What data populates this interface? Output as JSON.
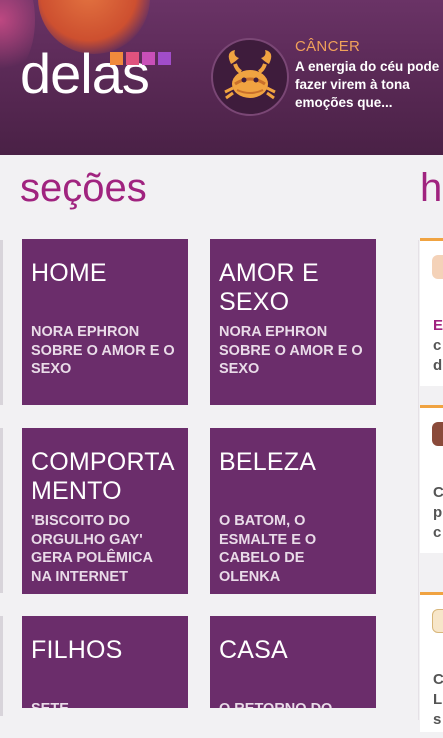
{
  "brand": {
    "logo_text": "delas",
    "logo_squares": [
      "#f08a3c",
      "#e0527e",
      "#c94fb8",
      "#a14dc9"
    ]
  },
  "horoscope": {
    "sign": "CÂNCER",
    "text": "A energia do céu pode fazer virem à tona emoções que...",
    "icon": "crab-icon"
  },
  "sections_heading": "seções",
  "next_panel_heading": "h",
  "tiles": [
    {
      "title": "HOME",
      "subtitle": "NORA EPHRON SOBRE O AMOR E O SEXO"
    },
    {
      "title": "AMOR E SEXO",
      "subtitle": "NORA EPHRON SOBRE O AMOR E O SEXO"
    },
    {
      "title": "COMPORTA MENTO",
      "subtitle": "'BISCOITO DO ORGULHO GAY' GERA POLÊMICA NA INTERNET"
    },
    {
      "title": "BELEZA",
      "subtitle": "O BATOM, O ESMALTE E O CABELO DE OLENKA"
    },
    {
      "title": "FILHOS",
      "subtitle": "SETE"
    },
    {
      "title": "CASA",
      "subtitle": "O RETORNO DO"
    }
  ],
  "side_cards": [
    {
      "letters": [
        "E",
        "c",
        "d"
      ]
    },
    {
      "letters": [
        "C",
        "p",
        "c"
      ]
    },
    {
      "letters": [
        "C",
        "L",
        "s"
      ]
    }
  ],
  "colors": {
    "header": "#5b2a57",
    "tile": "#6b2d6b",
    "accent": "#a0237f",
    "horoscope_title": "#f0a15a",
    "card_border": "#f0a341"
  }
}
